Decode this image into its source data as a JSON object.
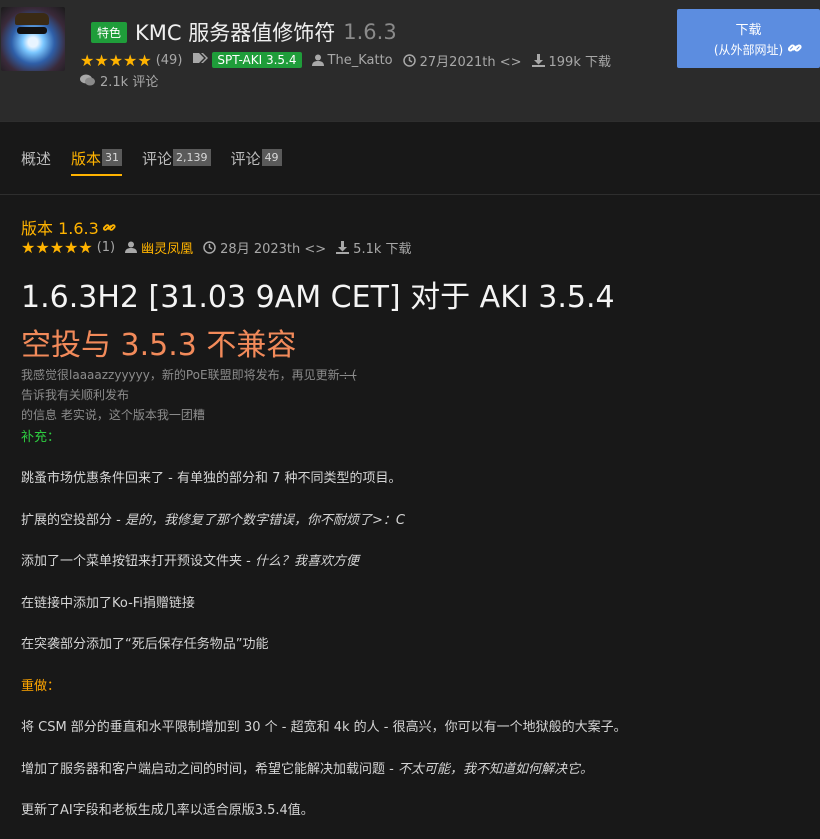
{
  "header": {
    "featured_badge": "特色",
    "title": "KMC 服务器值修饰符",
    "version": "1.6.3",
    "rating_stars": 5,
    "rating_count": "(49)",
    "game_version_badge": "SPT-AKI 3.5.4",
    "author": "The_Katto",
    "date": "27月2021th <>",
    "downloads": "199k 下载",
    "comments": "2.1k 评论"
  },
  "download_button": {
    "label": "下载",
    "sublabel": "(从外部网址)"
  },
  "tabs": [
    {
      "label": "概述",
      "count": ""
    },
    {
      "label": "版本",
      "count": "31"
    },
    {
      "label": "评论",
      "count": "2,139"
    },
    {
      "label": "评论",
      "count": "49"
    }
  ],
  "version_block": {
    "heading": "版本 1.6.3",
    "rating_count": "(1)",
    "author": "幽灵凤凰",
    "date": "28月 2023th <>",
    "downloads": "5.1k 下载",
    "title": "1.6.3H2 [31.03 9AM CET] 对于 AKI 3.5.4",
    "subtitle": "空投与 3.5.3 不兼容",
    "note_line1_a": "我感觉很laaaazzyyyyy，新的PoE联盟即将发布，再见更新",
    "note_line1_b": " :-(",
    "note_line2": "告诉我有关顺利发布",
    "note_line3": "的信息 老实说，这个版本我一团糟"
  },
  "changelog": {
    "additions_heading": "补充：",
    "items": [
      {
        "text": "跳蚤市场优惠条件回来了 - 有单独的部分和 7 种不同类型的项目。",
        "comment": ""
      },
      {
        "text": "扩展的空投部分 - ",
        "comment": "是的，我修复了那个数字错误，你不耐烦了>：C"
      },
      {
        "text": "添加了一个菜单按钮来打开预设文件夹 - ",
        "comment": "什么？我喜欢方便"
      },
      {
        "text": "在链接中添加了Ko-Fi捐赠链接",
        "comment": ""
      },
      {
        "text": "在突袭部分添加了“死后保存任务物品”功能",
        "comment": ""
      }
    ],
    "rework_heading": "重做：",
    "rework_items": [
      {
        "text": "将 CSM 部分的垂直和水平限制增加到 30 个 - 超宽和 4k 的人 - 很高兴，你可以有一个地狱般的大案子。",
        "comment": ""
      },
      {
        "text": "增加了服务器和客户端启动之间的时间，希望它能解决加载问题 - ",
        "comment": "不太可能，我不知道如何解决它。"
      },
      {
        "text": "更新了AI字段和老板生成几率以适合原版3.5.4值。",
        "comment": ""
      }
    ]
  },
  "colors": {
    "accent": "#ffb300",
    "featured_green": "#1f9d3a",
    "download_blue": "#5c8de0",
    "subtitle_orange": "#f28a5a"
  }
}
